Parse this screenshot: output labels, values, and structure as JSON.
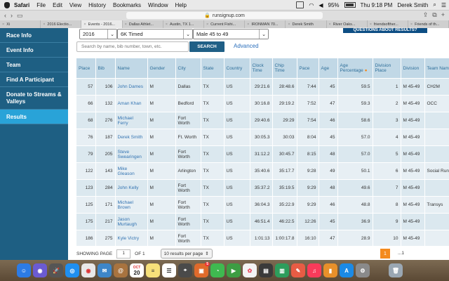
{
  "menubar": {
    "items": [
      "Safari",
      "File",
      "Edit",
      "View",
      "History",
      "Bookmarks",
      "Window",
      "Help"
    ],
    "battery": "95%",
    "clock": "Thu 9:18 PM",
    "user": "Derek Smith"
  },
  "browser": {
    "url": "runsignup.com",
    "tabs": [
      "Xi",
      "2016 Electio...",
      "Events - 2016...",
      "Dallas Athlet...",
      "Austin, TX 1...",
      "Current Fishi...",
      "IRONMAN 70...",
      "Derek Smith",
      "River Oaks...",
      "friendsofther...",
      "Friends of th..."
    ]
  },
  "sidebar": {
    "items": [
      "Race Info",
      "Event Info",
      "Team",
      "Find A Participant",
      "Donate to Streams & Valleys",
      "Results"
    ]
  },
  "filters": {
    "year": "2016",
    "event": "6K Timed",
    "division": "Male 45 to 49",
    "questions_label": "QUESTIONS ABOUT RESULTS?",
    "search_placeholder": "Search by name, bib number, town, etc.",
    "search_button": "SEARCH",
    "advanced": "Advanced"
  },
  "table": {
    "headers": [
      "Place",
      "Bib",
      "Name",
      "Gender",
      "City",
      "State",
      "Country",
      "Clock Time",
      "Chip Time",
      "Pace",
      "Age",
      "Age Percentage",
      "Division Place",
      "Division",
      "Team Name"
    ],
    "rows": [
      [
        "57",
        "106",
        "John Dames",
        "M",
        "Dallas",
        "TX",
        "US",
        "29:21.6",
        "28:48.6",
        "7:44",
        "45",
        "59.5",
        "1",
        "M 45-49",
        "CH2M"
      ],
      [
        "66",
        "132",
        "Aman Khan",
        "M",
        "Bedford",
        "TX",
        "US",
        "30:16.8",
        "29:19.2",
        "7:52",
        "47",
        "59.3",
        "2",
        "M 45-49",
        "OCC"
      ],
      [
        "68",
        "276",
        "Michael Ferry",
        "M",
        "Fort Worth",
        "TX",
        "US",
        "29:40.6",
        "29:29",
        "7:54",
        "46",
        "58.6",
        "3",
        "M 45-49",
        ""
      ],
      [
        "76",
        "187",
        "Derek Smith",
        "M",
        "Ft. Worth",
        "TX",
        "US",
        "30:05.3",
        "30:03",
        "8:04",
        "45",
        "57.0",
        "4",
        "M 45-49",
        ""
      ],
      [
        "79",
        "205",
        "Steve Swearingen",
        "M",
        "Fort Worth",
        "TX",
        "US",
        "31:12.2",
        "30:45.7",
        "8:15",
        "48",
        "57.0",
        "5",
        "M 45-49",
        ""
      ],
      [
        "122",
        "143",
        "Mike Gleason",
        "M",
        "Arlington",
        "TX",
        "US",
        "35:40.6",
        "35:17.7",
        "9:28",
        "49",
        "50.1",
        "6",
        "M 45-49",
        "Social Running"
      ],
      [
        "123",
        "284",
        "John Kelly",
        "M",
        "Fort Worth",
        "TX",
        "US",
        "35:37.2",
        "35:19.5",
        "9:29",
        "48",
        "49.6",
        "7",
        "M 45-49",
        ""
      ],
      [
        "125",
        "171",
        "Michael Brown",
        "M",
        "Fort Worth",
        "TX",
        "US",
        "36:04.3",
        "35:22.9",
        "9:29",
        "46",
        "48.8",
        "8",
        "M 45-49",
        "Transys"
      ],
      [
        "175",
        "217",
        "Jason Murtaugh",
        "M",
        "Fort Worth",
        "TX",
        "US",
        "46:51.4",
        "46:22.5",
        "12:26",
        "45",
        "36.9",
        "9",
        "M 45-49",
        ""
      ],
      [
        "186",
        "275",
        "Kyle Victry",
        "M",
        "Fort Worth",
        "TX",
        "US",
        "1:01:13",
        "1:00:17.8",
        "16:10",
        "47",
        "28.9",
        "10",
        "M 45-49",
        ""
      ]
    ]
  },
  "footer": {
    "showing_page": "SHOWING PAGE",
    "page_value": "1",
    "of_label": "OF 1",
    "per_page": "10 results per page",
    "page_button": "1",
    "more": "...1"
  },
  "dock": {
    "calendar_month": "OCT",
    "calendar_day": "20",
    "badge": "5"
  }
}
